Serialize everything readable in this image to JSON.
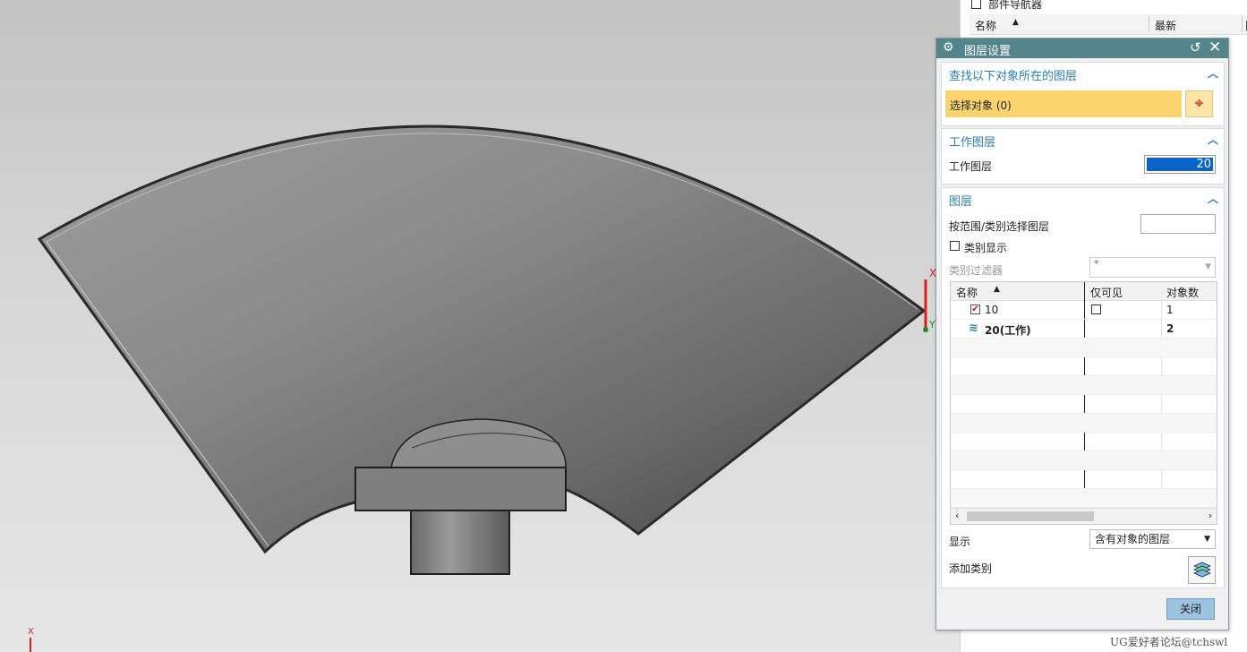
{
  "navigator": {
    "title": "部件导航器",
    "col_name": "名称",
    "col_latest": "最新",
    "col_extra": "附"
  },
  "dialog": {
    "title": "图层设置",
    "find_section": {
      "title": "查找以下对象所在的图层",
      "select_label": "选择对象 (0)"
    },
    "work_section": {
      "title": "工作图层",
      "label": "工作图层",
      "value": "20"
    },
    "layer_section": {
      "title": "图层",
      "range_label": "按范围/类别选择图层",
      "range_value": "",
      "category_display_label": "类别显示",
      "category_display_checked": false,
      "filter_label": "类别过滤器",
      "filter_value": "*",
      "table": {
        "col_name": "名称",
        "col_visible": "仅可见",
        "col_count": "对象数",
        "rows": [
          {
            "name": "10",
            "visible_only": false,
            "count": "1",
            "checked": true
          },
          {
            "name": "20(工作)",
            "visible_only": null,
            "count": "2",
            "work": true
          }
        ]
      },
      "show_label": "显示",
      "show_value": "含有对象的图层",
      "add_category_label": "添加类别"
    },
    "close_label": "关闭"
  },
  "viewport": {
    "axis_x_label": "X",
    "axis_label_side": "Y",
    "axis_corner_label": "X"
  },
  "watermark": "UG爱好者论坛@tchswl"
}
